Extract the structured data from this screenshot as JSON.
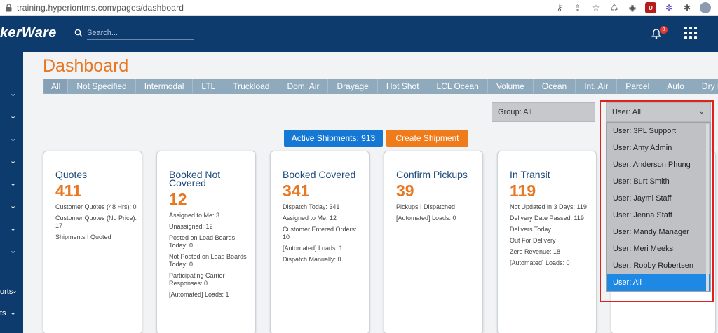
{
  "browser": {
    "url": "training.hyperiontms.com/pages/dashboard"
  },
  "nav": {
    "brand": "kerWare",
    "search_placeholder": "Search...",
    "notification_count": "0"
  },
  "sidebar": {
    "labels": [
      "orts",
      "ts"
    ]
  },
  "page_title": "Dashboard",
  "tabs": [
    "All",
    "Not Specified",
    "Intermodal",
    "LTL",
    "Truckload",
    "Dom. Air",
    "Drayage",
    "Hot Shot",
    "LCL Ocean",
    "Volume",
    "Ocean",
    "Int. Air",
    "Parcel",
    "Auto",
    "Dry Bu"
  ],
  "filters": {
    "group": "Group: All",
    "user": "User: All"
  },
  "buttons": {
    "active_shipments": "Active Shipments: 913",
    "create_shipment": "Create Shipment"
  },
  "cards": [
    {
      "title": "Quotes",
      "count": "411",
      "lines": [
        "Customer Quotes (48 Hrs): 0",
        "Customer Quotes (No Price): 17",
        "Shipments I Quoted"
      ]
    },
    {
      "title": "Booked Not Covered",
      "count": "12",
      "lines": [
        "Assigned to Me: 3",
        "Unassigned: 12",
        "Posted on Load Boards Today: 0",
        "Not Posted on Load Boards Today: 0",
        "Participating Carrier Responses: 0",
        "[Automated] Loads: 1"
      ]
    },
    {
      "title": "Booked Covered",
      "count": "341",
      "lines": [
        "Dispatch Today: 341",
        "Assigned to Me: 12",
        "Customer Entered Orders: 10",
        "[Automated] Loads: 1",
        "Dispatch Manually: 0"
      ]
    },
    {
      "title": "Confirm Pickups",
      "count": "39",
      "lines": [
        "Pickups I Dispatched",
        "[Automated] Loads: 0"
      ]
    },
    {
      "title": "In Transit",
      "count": "119",
      "lines": [
        "Not Updated in 3 Days: 119",
        "Delivery Date Passed: 119",
        "Delivers Today",
        "Out For Delivery",
        "Zero Revenue: 18",
        "[Automated] Loads: 0"
      ]
    }
  ],
  "user_options": [
    "User: 3PL Support",
    "User: Amy Admin",
    "User: Anderson Phung",
    "User: Burt Smith",
    "User: Jaymi Staff",
    "User: Jenna Staff",
    "User: Mandy Manager",
    "User: Meri Meeks",
    "User: Robby Robertsen",
    "User: All"
  ],
  "selected_user_index": 9
}
